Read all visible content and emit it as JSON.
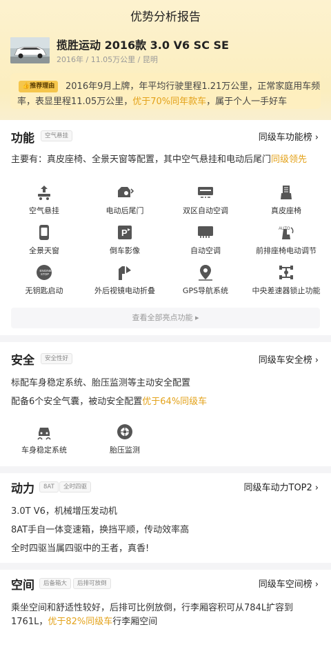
{
  "header": {
    "title": "优势分析报告"
  },
  "car": {
    "name": "揽胜运动 2016款 3.0 V6 SC SE",
    "meta": "2016年 / 11.05万公里 / 昆明"
  },
  "reason": {
    "tag": "推荐理由",
    "text_a": "2016年9月上牌，年平均行驶里程1.21万公里，正常家庭用车频率，表显里程11.05万公里，",
    "highlight": "优于70%同年款车",
    "text_b": "，属于个人一手好车"
  },
  "function_section": {
    "title": "功能",
    "tag": "空气悬挂",
    "rank": "同级车功能榜",
    "summary_a": "主要有：真皮座椅、全景天窗等配置，其中空气悬挂和电动后尾门",
    "summary_hl": "同级领先",
    "features": [
      {
        "label": "空气悬挂",
        "icon": "air-suspension-icon"
      },
      {
        "label": "电动后尾门",
        "icon": "power-tailgate-icon"
      },
      {
        "label": "双区自动空调",
        "icon": "dual-zone-ac-icon"
      },
      {
        "label": "真皮座椅",
        "icon": "leather-seat-icon"
      },
      {
        "label": "全景天窗",
        "icon": "panoramic-sunroof-icon"
      },
      {
        "label": "倒车影像",
        "icon": "parking-camera-icon"
      },
      {
        "label": "自动空调",
        "icon": "auto-ac-icon"
      },
      {
        "label": "前排座椅电动调节",
        "icon": "power-seat-icon"
      },
      {
        "label": "无钥匙启动",
        "icon": "keyless-start-icon"
      },
      {
        "label": "外后视镜电动折叠",
        "icon": "mirror-fold-icon"
      },
      {
        "label": "GPS导航系统",
        "icon": "gps-icon"
      },
      {
        "label": "中央差速器锁止功能",
        "icon": "diff-lock-icon"
      }
    ],
    "view_all": "查看全部亮点功能 ▸"
  },
  "safety_section": {
    "title": "安全",
    "tag": "安全性好",
    "rank": "同级车安全榜",
    "line1": "标配车身稳定系统、胎压监测等主动安全配置",
    "line2_a": "配备6个安全气囊，被动安全配置",
    "line2_hl": "优于64%同级车",
    "features": [
      {
        "label": "车身稳定系统",
        "icon": "stability-control-icon"
      },
      {
        "label": "胎压监测",
        "icon": "tire-pressure-icon"
      }
    ]
  },
  "power_section": {
    "title": "动力",
    "tags": [
      "8AT",
      "全时四驱"
    ],
    "rank": "同级车动力TOP2",
    "lines": [
      "3.0T V6，机械增压发动机",
      "8AT手自一体变速箱，换挡平顺，传动效率高",
      "全时四驱当属四驱中的王者，真香!"
    ]
  },
  "space_section": {
    "title": "空间",
    "tags": [
      "后备箱大",
      "后排可放倒"
    ],
    "rank": "同级车空间榜",
    "line1": "乘坐空间和舒适性较好，后排可比例放倒，行李厢容积可从784L扩容到",
    "line2_a": "1761L，",
    "line2_hl": "优于82%同级车",
    "line2_b": "行李厢空间"
  },
  "colors": {
    "accent": "#e3a21a",
    "tag_bg": "#f5c64c"
  }
}
